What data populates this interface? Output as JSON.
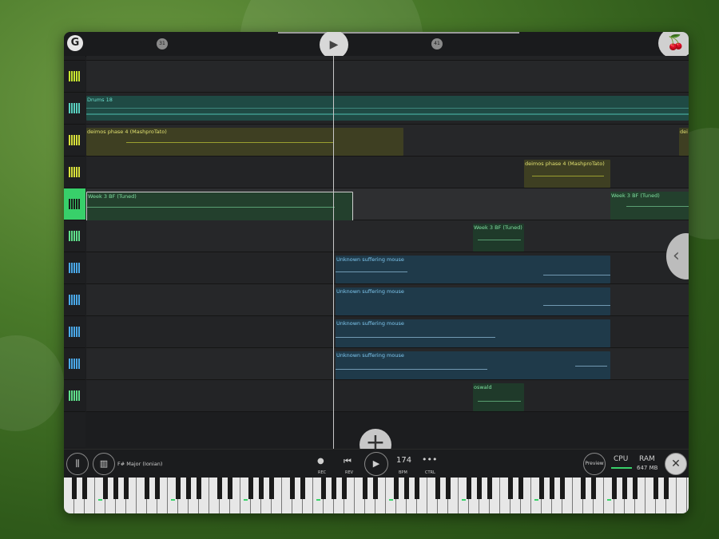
{
  "transport": {
    "rec_label": "REC",
    "rev_label": "REV",
    "tempo": "174",
    "bpm_label": "BPM",
    "ctrl_label": "CTRL",
    "play_symbol": "▶"
  },
  "header": {
    "marker_a": "31",
    "marker_b": "41",
    "logo_glyph": "G"
  },
  "scale": {
    "label": "F# Major (Ionian)"
  },
  "status": {
    "preview_label": "Preview",
    "cpu_label": "CPU",
    "ram_label": "RAM",
    "ram_value": "647 MB"
  },
  "clips": [
    {
      "name": "Drums 18"
    },
    {
      "name": "deimos phase 4 (MashproTato)"
    },
    {
      "name": "dei"
    },
    {
      "name": "deimos phase 4 (MashproTato)"
    },
    {
      "name": "Week 3 BF (Tuned)"
    },
    {
      "name": "Week 3 BF (Tuned)"
    },
    {
      "name": "Week 3 BF (Tuned)"
    },
    {
      "name": "Unknown suffering mouse"
    },
    {
      "name": "Unknown suffering mouse"
    },
    {
      "name": "Unknown suffering mouse"
    },
    {
      "name": "Unknown suffering mouse"
    },
    {
      "name": "oswald"
    }
  ],
  "colors": {
    "drums": "#1f4a44",
    "yellow": "#3e3f22",
    "green": "#1f3a2a",
    "blue": "#1f3a4a",
    "selected": "#38d06a"
  }
}
